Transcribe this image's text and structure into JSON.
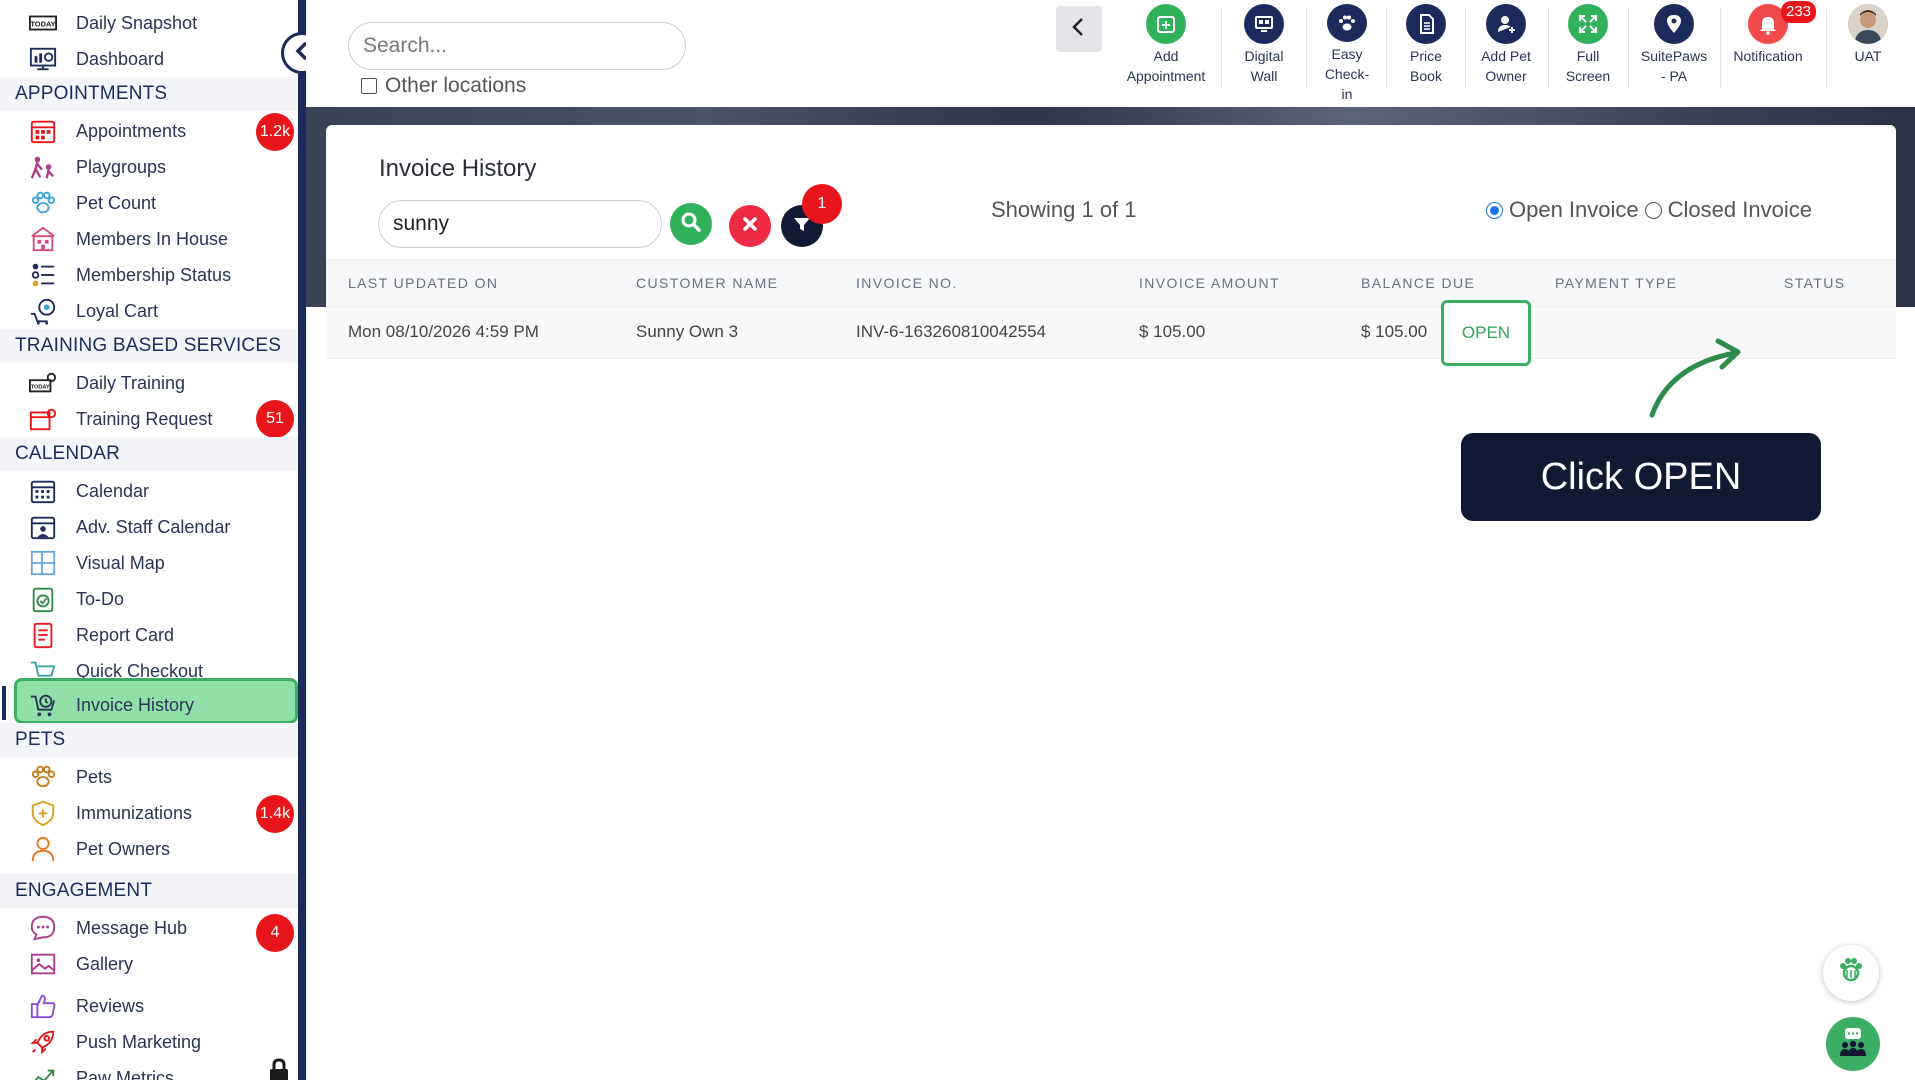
{
  "sidebar": {
    "items": [
      {
        "label": "Daily Snapshot"
      },
      {
        "label": "Dashboard"
      },
      {
        "label": "Appointments",
        "badge": "1.2k"
      },
      {
        "label": "Playgroups"
      },
      {
        "label": "Pet Count"
      },
      {
        "label": "Members In House"
      },
      {
        "label": "Membership Status"
      },
      {
        "label": "Loyal Cart"
      },
      {
        "label": "Daily Training"
      },
      {
        "label": "Training Request",
        "badge": "51"
      },
      {
        "label": "Calendar"
      },
      {
        "label": "Adv. Staff Calendar"
      },
      {
        "label": "Visual Map"
      },
      {
        "label": "To-Do"
      },
      {
        "label": "Report Card"
      },
      {
        "label": "Quick Checkout"
      },
      {
        "label": "Invoice History"
      },
      {
        "label": "Pets"
      },
      {
        "label": "Immunizations",
        "badge": "1.4k"
      },
      {
        "label": "Pet Owners"
      },
      {
        "label": "Message Hub",
        "badge": "4"
      },
      {
        "label": "Gallery"
      },
      {
        "label": "Reviews"
      },
      {
        "label": "Push Marketing"
      },
      {
        "label": "Paw Metrics"
      }
    ],
    "sections": [
      "APPOINTMENTS",
      "TRAINING BASED SERVICES",
      "CALENDAR",
      "PETS",
      "ENGAGEMENT"
    ],
    "today_icon_text": "TODAY"
  },
  "topbar": {
    "search_placeholder": "Search...",
    "other_locations": "Other locations",
    "buttons": [
      {
        "line1": "Add",
        "line2": "Appointment",
        "color": "#2fb25a"
      },
      {
        "line1": "Digital",
        "line2": "Wall",
        "color": "#1d2b5c"
      },
      {
        "line1": "Easy",
        "line2": "Check-",
        "line3": "in",
        "color": "#1d2b5c"
      },
      {
        "line1": "Price",
        "line2": "Book",
        "color": "#1d2b5c"
      },
      {
        "line1": "Add Pet",
        "line2": "Owner",
        "color": "#1d2b5c"
      },
      {
        "line1": "Full",
        "line2": "Screen",
        "color": "#2fb25a"
      },
      {
        "line1": "SuitePaws",
        "line2": "- PA",
        "color": "#1d2b5c"
      },
      {
        "line1": "Notification",
        "badge": "233",
        "color": "#f04a4a"
      },
      {
        "line1": "UAT"
      }
    ]
  },
  "invoice": {
    "title": "Invoice History",
    "filter_value": "sunny",
    "filter_badge": "1",
    "showing": "Showing 1 of 1",
    "radio_open": "Open Invoice",
    "radio_closed": "Closed Invoice",
    "columns": [
      "LAST UPDATED ON",
      "CUSTOMER NAME",
      "INVOICE NO.",
      "INVOICE AMOUNT",
      "BALANCE DUE",
      "PAYMENT TYPE",
      "STATUS"
    ],
    "rows": [
      {
        "updated": "Mon 08/10/2026 4:59 PM",
        "customer": "Sunny Own 3",
        "invoice_no": "INV-6-163260810042554",
        "amount": "$ 105.00",
        "balance": "$ 105.00",
        "payment_type": "",
        "status": "OPEN"
      }
    ]
  },
  "callout": {
    "text": "Click OPEN"
  },
  "colors": {
    "navy": "#1d2b5c",
    "green": "#3cae63",
    "red": "#e8151b",
    "callout_bg": "#111a32"
  }
}
